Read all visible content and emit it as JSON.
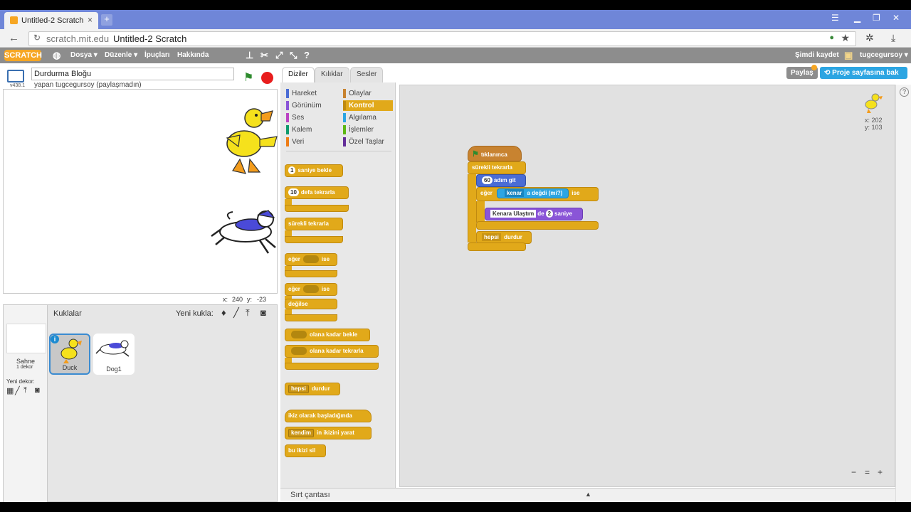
{
  "browser": {
    "tab_title": "Untitled-2 Scratch",
    "tab_close": "×",
    "new_tab": "+",
    "url_host": "scratch.mit.edu",
    "url_title": "Untitled-2 Scratch"
  },
  "menubar": {
    "logo": "SCRATCH",
    "items": [
      "Dosya ▾",
      "Düzenle ▾",
      "İpuçları",
      "Hakkında"
    ],
    "save_now": "Şimdi kaydet",
    "username": "tugcegursoy ▾"
  },
  "stage": {
    "project_title": "Durdurma Bloğu",
    "owner_text": "yapan tugcegursoy (paylaşmadın)",
    "version": "v438.1",
    "coord_x_label": "x:",
    "coord_x": "240",
    "coord_y_label": "y:",
    "coord_y": "-23"
  },
  "sprites_pane": {
    "header": "Kuklalar",
    "new_sprite": "Yeni kukla:",
    "stage_label": "Sahne",
    "stage_backdrops": "1 dekor",
    "new_backdrop": "Yeni dekor:",
    "sprites": [
      {
        "name": "Duck",
        "selected": true
      },
      {
        "name": "Dog1",
        "selected": false
      }
    ]
  },
  "palette": {
    "tabs": [
      "Diziler",
      "Kılıklar",
      "Sesler"
    ],
    "categories_left": [
      {
        "label": "Hareket",
        "color": "#4a6cd4"
      },
      {
        "label": "Görünüm",
        "color": "#8a55d7"
      },
      {
        "label": "Ses",
        "color": "#bb42c3"
      },
      {
        "label": "Kalem",
        "color": "#0e9a6c"
      },
      {
        "label": "Veri",
        "color": "#ee7d16"
      }
    ],
    "categories_right": [
      {
        "label": "Olaylar",
        "color": "#c88330"
      },
      {
        "label": "Kontrol",
        "color": "#e1a91a",
        "selected": true
      },
      {
        "label": "Algılama",
        "color": "#2ca5e2"
      },
      {
        "label": "İşlemler",
        "color": "#5cb712"
      },
      {
        "label": "Özel Taşlar",
        "color": "#632d99"
      }
    ],
    "blocks": {
      "wait_num": "1",
      "wait": "saniye bekle",
      "repeat_num": "10",
      "repeat": "defa tekrarla",
      "forever": "sürekli tekrarla",
      "if": "eğer",
      "then": "ise",
      "ifelse_if": "eğer",
      "ifelse_then": "ise",
      "else": "değilse",
      "wait_until": "olana kadar bekle",
      "repeat_until": "olana kadar tekrarla",
      "stop_drop": "hepsi",
      "stop": "durdur",
      "clone_start": "ikiz olarak başladığında",
      "clone_drop": "kendim",
      "clone_create": "in ikizini yarat",
      "clone_delete": "bu ikizi sil"
    }
  },
  "header_buttons": {
    "share": "Paylaş",
    "project_page": "Proje sayfasına bak"
  },
  "scripts": {
    "hat": "tıklanınca",
    "forever": "sürekli tekrarla",
    "move_num": "60",
    "move": "adım git",
    "if": "eğer",
    "touching_drop": "kenar",
    "touching": "a değdi (mi?)",
    "then": "ise",
    "say_text": "Kenara Ulaştım",
    "say_mid": "de",
    "say_num": "2",
    "say_end": "saniye",
    "stop_drop": "hepsi",
    "stop": "durdur"
  },
  "sprite_info": {
    "x_label": "x:",
    "x": "202",
    "y_label": "y:",
    "y": "103"
  },
  "backpack": {
    "label": "Sırt çantası",
    "arrow": "▲"
  },
  "zoom": [
    "−",
    "=",
    "+"
  ],
  "help": "?"
}
